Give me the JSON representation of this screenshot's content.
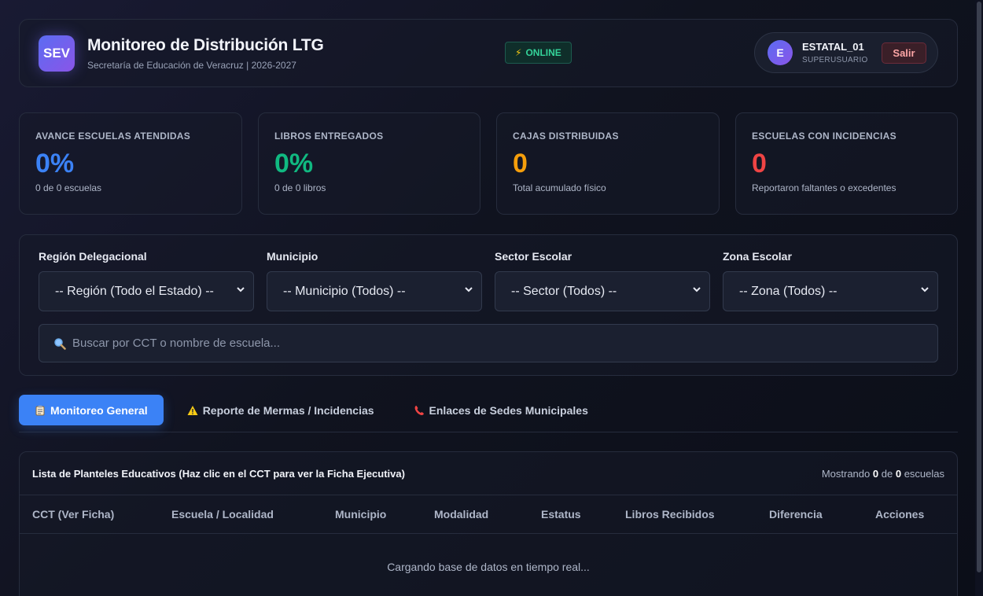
{
  "header": {
    "logo_text": "SEV",
    "title": "Monitoreo de Distribución LTG",
    "subtitle": "Secretaría de Educación de Veracruz | 2026-2027",
    "status": "ONLINE",
    "user": {
      "initial": "E",
      "name": "ESTATAL_01",
      "role": "SUPERUSUARIO",
      "logout_label": "Salir"
    }
  },
  "stats": [
    {
      "label": "AVANCE ESCUELAS ATENDIDAS",
      "value": "0%",
      "desc": "0 de 0 escuelas",
      "color": "#3b82f6"
    },
    {
      "label": "LIBROS ENTREGADOS",
      "value": "0%",
      "desc": "0 de 0 libros",
      "color": "#10b981"
    },
    {
      "label": "CAJAS DISTRIBUIDAS",
      "value": "0",
      "desc": "Total acumulado físico",
      "color": "#f59e0b"
    },
    {
      "label": "ESCUELAS CON INCIDENCIAS",
      "value": "0",
      "desc": "Reportaron faltantes o excedentes",
      "color": "#ef4444"
    }
  ],
  "filters": {
    "region": {
      "label": "Región Delegacional",
      "value": "-- Región (Todo el Estado) --"
    },
    "municipio": {
      "label": "Municipio",
      "value": "-- Municipio (Todos) --"
    },
    "sector": {
      "label": "Sector Escolar",
      "value": "-- Sector (Todos) --"
    },
    "zona": {
      "label": "Zona Escolar",
      "value": "-- Zona (Todos) --"
    },
    "search_placeholder": "Buscar por CCT o nombre de escuela..."
  },
  "tabs": [
    {
      "label": "Monitoreo General",
      "icon": "clipboard-icon"
    },
    {
      "label": "Reporte de Mermas / Incidencias",
      "icon": "warning-icon"
    },
    {
      "label": "Enlaces de Sedes Municipales",
      "icon": "phone-icon"
    }
  ],
  "table": {
    "title": "Lista de Planteles Educativos (Haz clic en el CCT para ver la Ficha Ejecutiva)",
    "count_prefix": "Mostrando",
    "shown": "0",
    "count_mid": "de",
    "total": "0",
    "count_suffix": "escuelas",
    "columns": [
      "CCT (Ver Ficha)",
      "Escuela / Localidad",
      "Municipio",
      "Modalidad",
      "Estatus",
      "Libros Recibidos",
      "Diferencia",
      "Acciones"
    ],
    "loading_text": "Cargando base de datos en tiempo real..."
  }
}
